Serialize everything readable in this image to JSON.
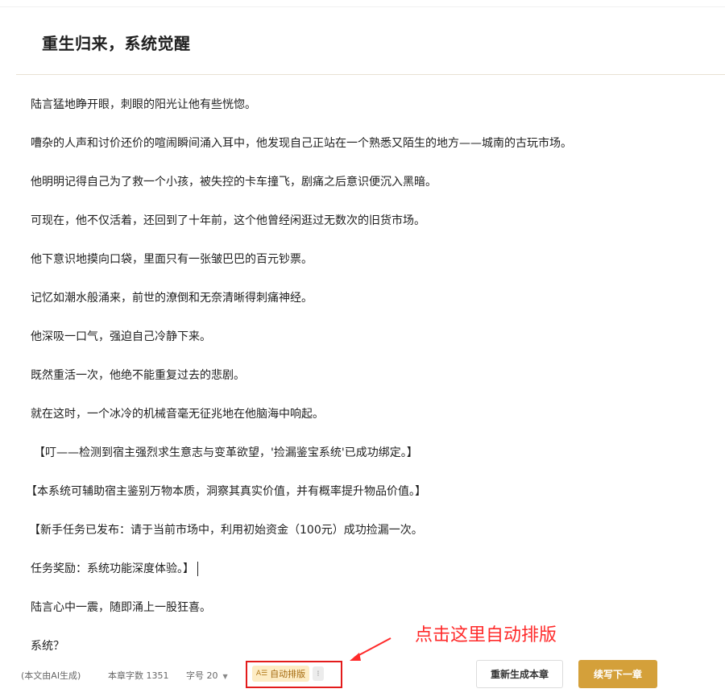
{
  "chapter": {
    "title": "重生归来，系统觉醒"
  },
  "paragraphs": [
    "陆言猛地睁开眼，刺眼的阳光让他有些恍惚。",
    "嘈杂的人声和讨价还价的喧闹瞬间涌入耳中，他发现自己正站在一个熟悉又陌生的地方——城南的古玩市场。",
    "他明明记得自己为了救一个小孩，被失控的卡车撞飞，剧痛之后意识便沉入黑暗。",
    "可现在，他不仅活着，还回到了十年前，这个他曾经闲逛过无数次的旧货市场。",
    "他下意识地摸向口袋，里面只有一张皱巴巴的百元钞票。",
    "记忆如潮水般涌来，前世的潦倒和无奈清晰得刺痛神经。",
    "他深吸一口气，强迫自己冷静下来。",
    "既然重活一次，他绝不能重复过去的悲剧。",
    "就在这时，一个冰冷的机械音毫无征兆地在他脑海中响起。",
    "【叮——检测到宿主强烈求生意志与变革欲望，'捡漏鉴宝系统'已成功绑定。】",
    "【本系统可辅助宿主鉴别万物本质，洞察其真实价值，并有概率提升物品价值。】",
    "【新手任务已发布：请于当前市场中，利用初始资金（100元）成功捡漏一次。",
    "任务奖励：系统功能深度体验。】",
    "陆言心中一震，随即涌上一股狂喜。",
    "系统？"
  ],
  "annotation": {
    "text": "点击这里自动排版",
    "color": "#ff2a2a"
  },
  "footer": {
    "ai_note": "(本文由AI生成)",
    "word_count": "本章字数 1351",
    "font_size": "字号 20",
    "auto_format_label": "自动排版",
    "auto_format_icon": "format-text-icon",
    "more_label": "⁝",
    "regenerate_label": "重新生成本章",
    "next_label": "续写下一章"
  },
  "colors": {
    "accent": "#d4a03a",
    "auto_format_bg": "#fdecc4",
    "highlight_box": "#e31b1b"
  }
}
